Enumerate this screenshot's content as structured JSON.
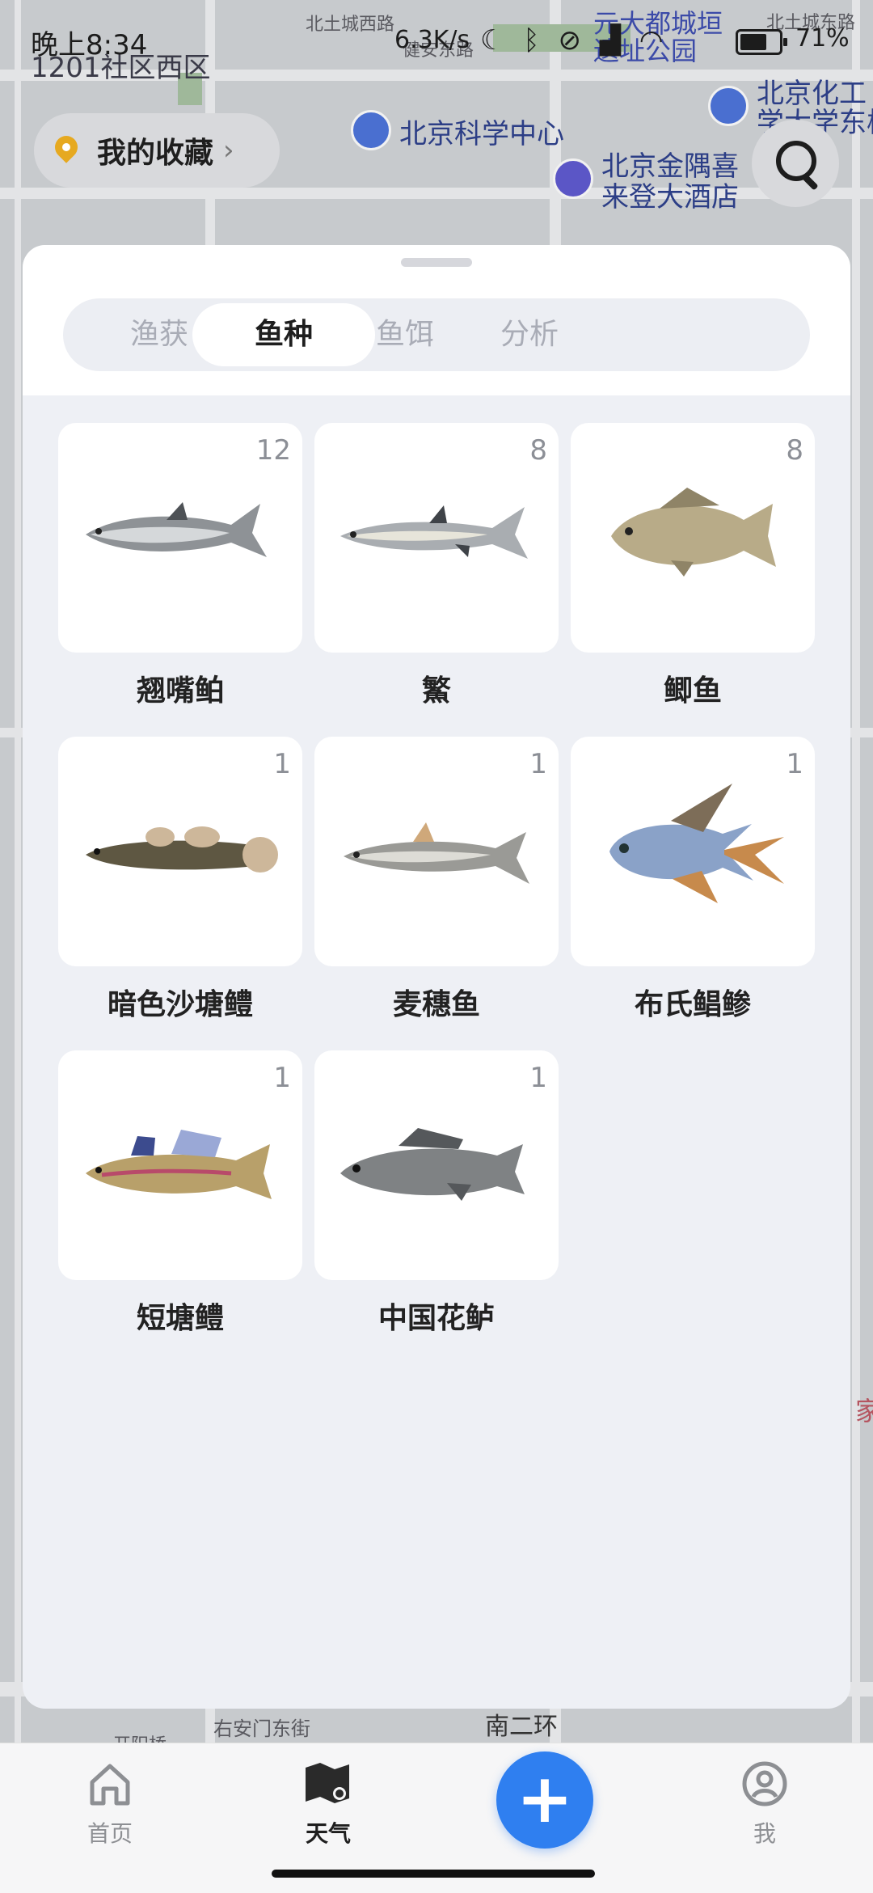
{
  "status_bar": {
    "time": "晚上8:34",
    "network_speed": "6.3K/s",
    "battery": "71%"
  },
  "map": {
    "labels": [
      "北土城西路",
      "1201社区西区",
      "元大都城垣",
      "遗址公园",
      "北土城东路",
      "北京化工",
      "学大学东校区",
      "北京科学中心",
      "北京金隅喜",
      "来登大酒店",
      "健安东路",
      "右安门东街",
      "南二环",
      "开阳桥",
      "家"
    ]
  },
  "favorites": {
    "label": "我的收藏"
  },
  "tabs": {
    "items": [
      {
        "label": "渔获"
      },
      {
        "label": "鱼种"
      },
      {
        "label": "鱼饵"
      },
      {
        "label": "分析"
      }
    ],
    "active_index": 1
  },
  "species": [
    {
      "name": "翘嘴鲌",
      "count": "12",
      "icon": "fish-silver-long-icon"
    },
    {
      "name": "鰵",
      "count": "8",
      "icon": "fish-silver-slim-icon"
    },
    {
      "name": "鲫鱼",
      "count": "8",
      "icon": "fish-crucian-icon"
    },
    {
      "name": "暗色沙塘鳢",
      "count": "1",
      "icon": "fish-goby-dark-icon"
    },
    {
      "name": "麦穗鱼",
      "count": "1",
      "icon": "fish-minnow-icon"
    },
    {
      "name": "布氏鲳鲹",
      "count": "1",
      "icon": "fish-pompano-icon"
    },
    {
      "name": "短塘鳢",
      "count": "1",
      "icon": "fish-goby-colorful-icon"
    },
    {
      "name": "中国花鲈",
      "count": "1",
      "icon": "fish-seabass-icon"
    }
  ],
  "bottom_nav": {
    "items": [
      {
        "label": "首页",
        "icon": "home-icon"
      },
      {
        "label": "天气",
        "icon": "weather-map-icon"
      },
      {
        "label": "我",
        "icon": "profile-icon"
      }
    ],
    "add_label": "+",
    "active_index": 1
  },
  "colors": {
    "accent": "#2f7ff0",
    "sheet_bg": "#eef0f5",
    "active_tab_text": "#1e1e1e",
    "inactive_tab_text": "#a9acb6"
  }
}
